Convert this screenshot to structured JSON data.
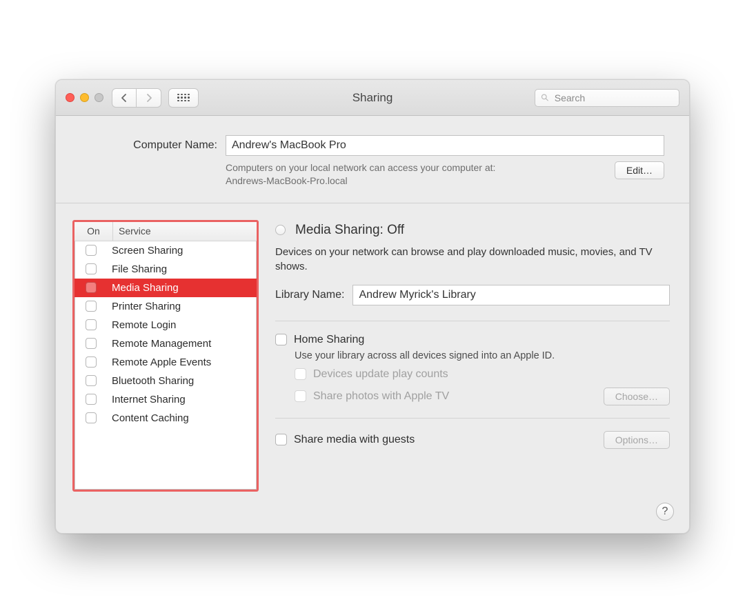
{
  "window": {
    "title": "Sharing"
  },
  "search": {
    "placeholder": "Search"
  },
  "computer_name": {
    "label": "Computer Name:",
    "value": "Andrew's MacBook Pro",
    "helper_line1": "Computers on your local network can access your computer at:",
    "helper_line2": "Andrews-MacBook-Pro.local",
    "edit_button": "Edit…"
  },
  "services": {
    "header_on": "On",
    "header_service": "Service",
    "items": [
      {
        "label": "Screen Sharing"
      },
      {
        "label": "File Sharing"
      },
      {
        "label": "Media Sharing"
      },
      {
        "label": "Printer Sharing"
      },
      {
        "label": "Remote Login"
      },
      {
        "label": "Remote Management"
      },
      {
        "label": "Remote Apple Events"
      },
      {
        "label": "Bluetooth Sharing"
      },
      {
        "label": "Internet Sharing"
      },
      {
        "label": "Content Caching"
      }
    ]
  },
  "detail": {
    "status": "Media Sharing: Off",
    "description": "Devices on your network can browse and play downloaded music, movies, and TV shows.",
    "library_label": "Library Name:",
    "library_value": "Andrew Myrick's Library",
    "home_sharing": "Home Sharing",
    "home_sharing_sub": "Use your library across all devices signed into an Apple ID.",
    "devices_update": "Devices update play counts",
    "share_photos": "Share photos with Apple TV",
    "choose_button": "Choose…",
    "share_guests": "Share media with guests",
    "options_button": "Options…"
  },
  "help": "?"
}
